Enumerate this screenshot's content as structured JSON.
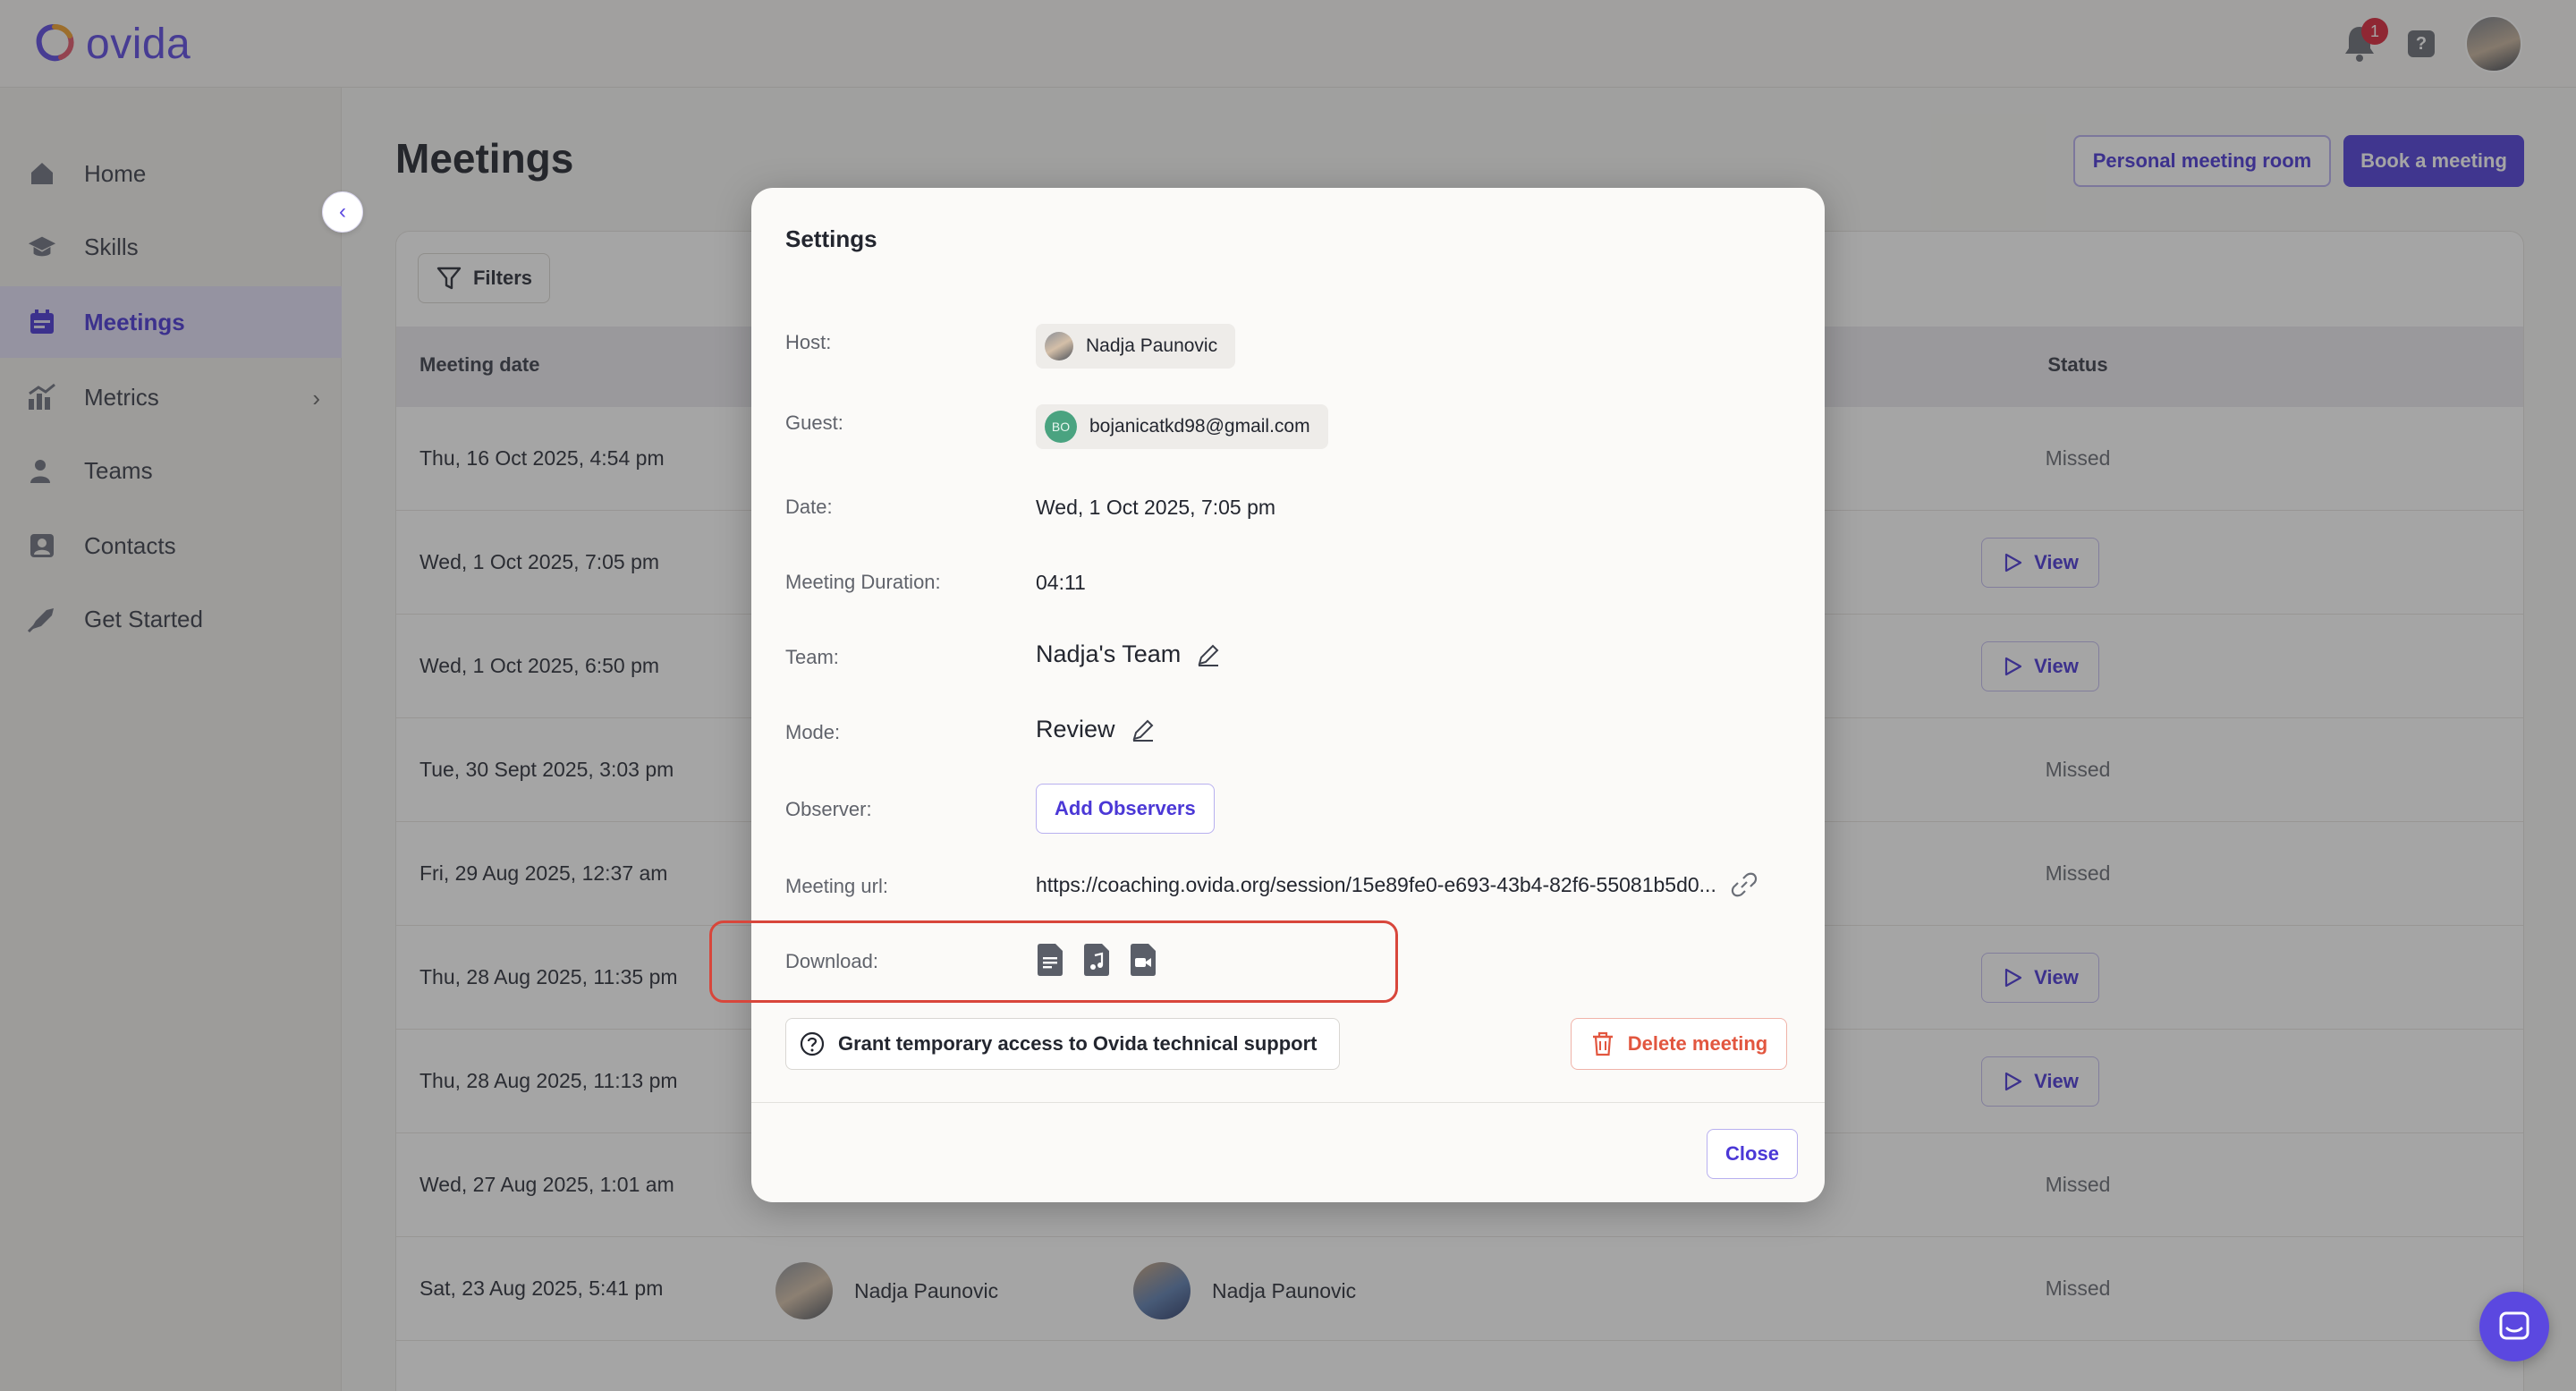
{
  "app": {
    "name": "ovida",
    "notification_count": "1",
    "help_glyph": "?"
  },
  "sidebar": {
    "items": [
      {
        "label": "Home",
        "icon": "home-icon"
      },
      {
        "label": "Skills",
        "icon": "graduation-cap-icon"
      },
      {
        "label": "Meetings",
        "icon": "calendar-icon",
        "active": true
      },
      {
        "label": "Metrics",
        "icon": "chart-icon"
      },
      {
        "label": "Teams",
        "icon": "users-icon"
      },
      {
        "label": "Contacts",
        "icon": "contact-card-icon"
      },
      {
        "label": "Get Started",
        "icon": "rocket-icon"
      }
    ]
  },
  "page": {
    "title": "Meetings",
    "personal_room_label": "Personal meeting room",
    "book_label": "Book a meeting",
    "filters_label": "Filters"
  },
  "table": {
    "columns": {
      "date": "Meeting date",
      "status": "Status"
    },
    "view_label": "View",
    "rows": [
      {
        "date": "Thu, 16 Oct 2025, 4:54 pm",
        "status": "Missed"
      },
      {
        "date": "Wed, 1 Oct 2025, 7:05 pm",
        "status": "View"
      },
      {
        "date": "Wed, 1 Oct 2025, 6:50 pm",
        "status": "View"
      },
      {
        "date": "Tue, 30 Sept 2025, 3:03 pm",
        "status": "Missed"
      },
      {
        "date": "Fri, 29 Aug 2025, 12:37 am",
        "status": "Missed"
      },
      {
        "date": "Thu, 28 Aug 2025, 11:35 pm",
        "status": "View"
      },
      {
        "date": "Thu, 28 Aug 2025, 11:13 pm",
        "status": "View"
      },
      {
        "date": "Wed, 27 Aug 2025, 1:01 am",
        "status": "Missed"
      },
      {
        "date": "Sat, 23 Aug 2025, 5:41 pm",
        "status": "Missed",
        "host": "Nadja Paunovic",
        "guest": "Nadja Paunovic"
      }
    ]
  },
  "modal": {
    "title": "Settings",
    "host_label": "Host:",
    "host_name": "Nadja Paunovic",
    "guest_label": "Guest:",
    "guest_initials": "BO",
    "guest_email": "bojanicatkd98@gmail.com",
    "date_label": "Date:",
    "date_value": "Wed, 1 Oct 2025, 7:05 pm",
    "duration_label": "Meeting Duration:",
    "duration_value": "04:11",
    "team_label": "Team:",
    "team_value": "Nadja's Team",
    "mode_label": "Mode:",
    "mode_value": "Review",
    "observer_label": "Observer:",
    "add_observers_label": "Add Observers",
    "url_label": "Meeting url:",
    "url_value": "https://coaching.ovida.org/session/15e89fe0-e693-43b4-82f6-55081b5d0...",
    "download_label": "Download:",
    "download_icons": [
      "transcript-file-icon",
      "audio-file-icon",
      "video-file-icon"
    ],
    "grant_label": "Grant temporary access to Ovida technical support",
    "delete_label": "Delete meeting",
    "close_label": "Close"
  },
  "colors": {
    "accent": "#5240d9",
    "danger": "#e2563f",
    "highlight": "#d8463b"
  }
}
